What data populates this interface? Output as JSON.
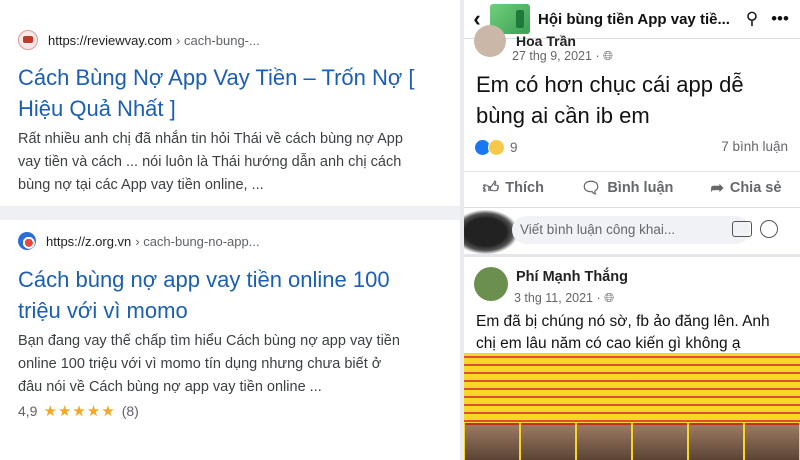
{
  "search": {
    "results": [
      {
        "domain": "https://reviewvay.com",
        "path": "› cach-bung-...",
        "title_line1": "Cách Bùng Nợ App Vay Tiền – Trốn Nợ [",
        "title_line2": "Hiệu Quả Nhất ]",
        "snippet_line1": "Rất nhiều anh chị đã nhắn tin hỏi Thái về cách bùng nợ App",
        "snippet_line2": "vay tiền và cách ... nói luôn là Thái hướng dẫn anh chị cách",
        "snippet_line3": "bùng nợ tại các App vay tiền online, ..."
      },
      {
        "domain": "https://z.org.vn",
        "path": "› cach-bung-no-app...",
        "title_line1": "Cách bùng nợ app vay tiền online 100",
        "title_line2": "triệu với vì momo",
        "snippet_line1": "Bạn đang vay thế chấp tìm hiểu Cách bùng nợ app vay tiền",
        "snippet_line2": "online 100 triệu với vì momo tín dụng nhưng chưa biết ở",
        "snippet_line3": "đâu nói về Cách bùng nợ app vay tiền online ...",
        "rating_value": "4,9",
        "stars": "★★★★★",
        "rating_count": "(8)"
      }
    ]
  },
  "facebook": {
    "group_name": "Hội bùng tiền App vay tiề...",
    "icons": {
      "back": "back-arrow-icon",
      "search": "search-icon",
      "more": "more-icon"
    },
    "post1": {
      "author": "Hoa Trần",
      "date": "27 thg 9, 2021 · ",
      "text_line1": "Em có hơn chục cái app dễ",
      "text_line2": "bùng ai cần ib em",
      "reaction_count": "9",
      "comment_count": "7 bình luận",
      "like_label": "Thích",
      "comment_label": "Bình luận",
      "share_label": "Chia sẻ"
    },
    "comment_placeholder": "Viết bình luận công khai...",
    "post2": {
      "author": "Phí Mạnh Thắng",
      "date": "3 thg 11, 2021 · ",
      "text_line1": "Em đã bị chúng nó sờ, fb ảo đăng lên. Anh",
      "text_line2": "chị em lâu năm có cao kiến gì không ạ"
    },
    "colors": {
      "link": "#1a5fb4",
      "star": "#f5a623",
      "flyer": "#f7d62a"
    }
  }
}
